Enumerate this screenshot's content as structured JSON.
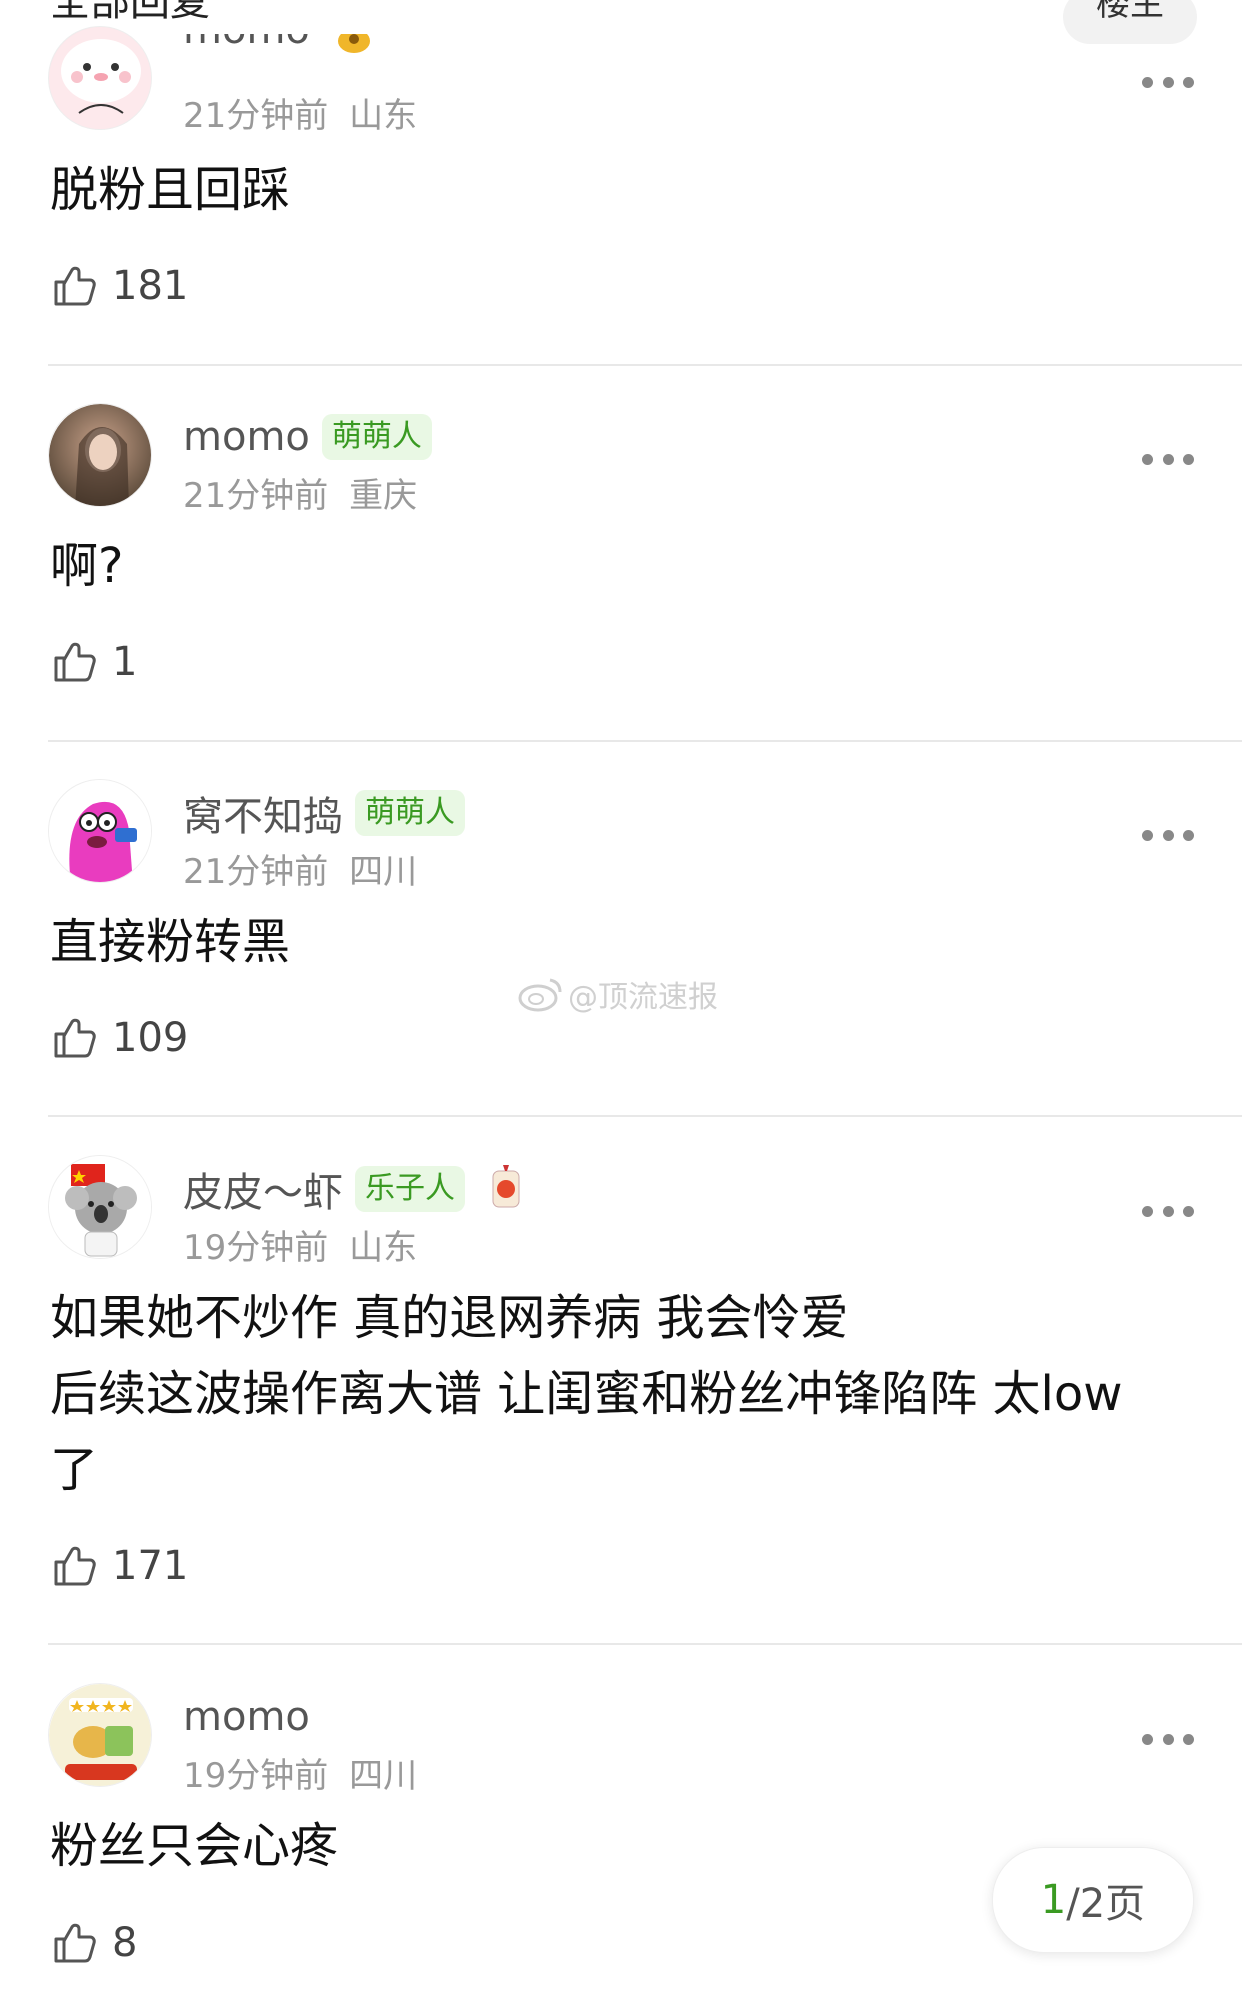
{
  "header": {
    "title": "全部回复",
    "sort_label": "楼主"
  },
  "comments": [
    {
      "username": "momo",
      "badge": "",
      "time": "21分钟前",
      "location": "山东",
      "text": "脱粉且回踩",
      "likes": "181"
    },
    {
      "username": "momo",
      "badge": "萌萌人",
      "time": "21分钟前",
      "location": "重庆",
      "text": "啊?",
      "likes": "1"
    },
    {
      "username": "窝不知捣",
      "badge": "萌萌人",
      "time": "21分钟前",
      "location": "四川",
      "text": "直接粉转黑",
      "likes": "109"
    },
    {
      "username": "皮皮～虾",
      "badge": "乐子人",
      "time": "19分钟前",
      "location": "山东",
      "text": "如果她不炒作 真的退网养病 我会怜爱\n后续这波操作离大谱 让闺蜜和粉丝冲锋陷阵 太low\n了",
      "likes": "171"
    },
    {
      "username": "momo",
      "badge": "",
      "time": "19分钟前",
      "location": "四川",
      "text": "粉丝只会心疼",
      "likes": "8"
    }
  ],
  "watermark": "@顶流速报",
  "pager": {
    "current": "1",
    "total_text": "/2页"
  },
  "colors": {
    "badge_green": "#3a9a22",
    "badge_bg": "#e9f8e4"
  },
  "icons": [
    "thumbs-up-icon",
    "more-dots-icon",
    "weibo-logo-icon",
    "badge-icon"
  ]
}
